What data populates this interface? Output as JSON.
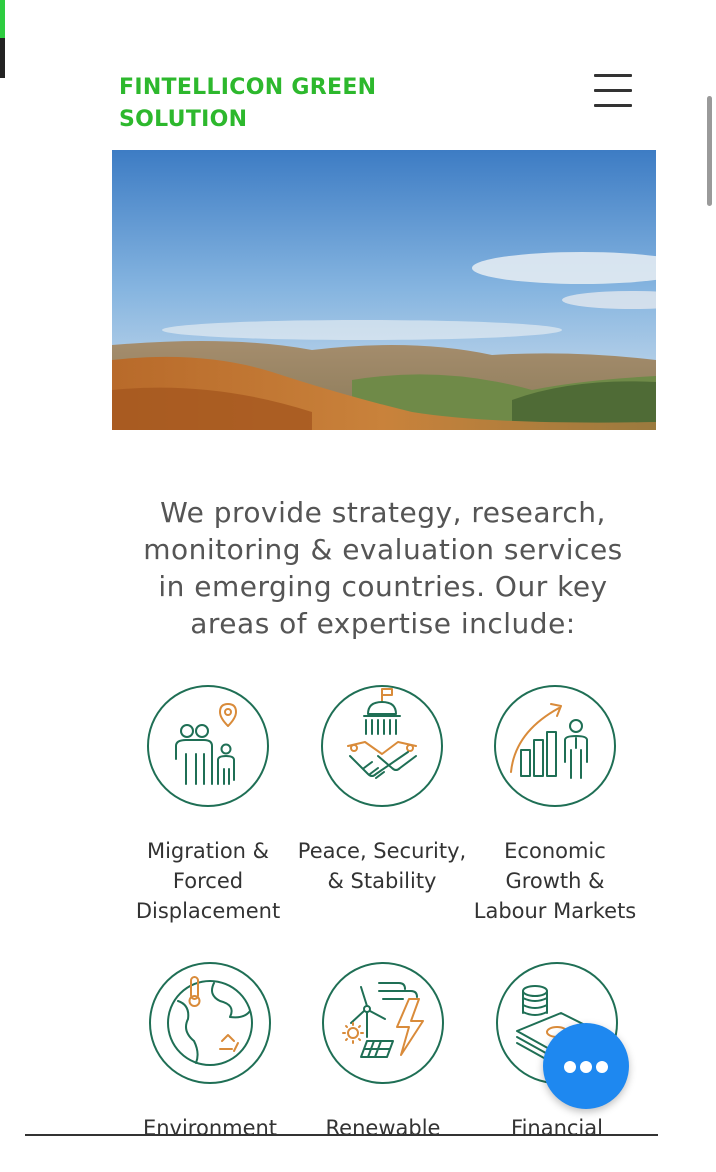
{
  "header": {
    "logo_line1": "FINTELLICON GREEN",
    "logo_line2": "SOLUTION",
    "logo_color": "#2db82d",
    "menu_icon": "hamburger-menu-icon"
  },
  "intro_text": "We provide strategy, research, monitoring & evaluation services in emerging countries. Our key areas of expertise include:",
  "expertise_areas": [
    {
      "label": "Migration &\nForced\nDisplacement",
      "icon": "migration-icon"
    },
    {
      "label": "Peace, Security,\n& Stability",
      "icon": "peace-handshake-icon"
    },
    {
      "label": "Economic\nGrowth &\nLabour Markets",
      "icon": "economic-growth-icon"
    },
    {
      "label": "Environment",
      "icon": "environment-globe-icon"
    },
    {
      "label": "Renewable",
      "icon": "renewable-energy-icon"
    },
    {
      "label": "Financial",
      "icon": "financial-money-icon"
    }
  ],
  "colors": {
    "icon_green": "#1f6f55",
    "icon_orange": "#d98b3a",
    "fab_blue": "#1e88f0"
  },
  "chat_button_icon": "more-dots-icon"
}
